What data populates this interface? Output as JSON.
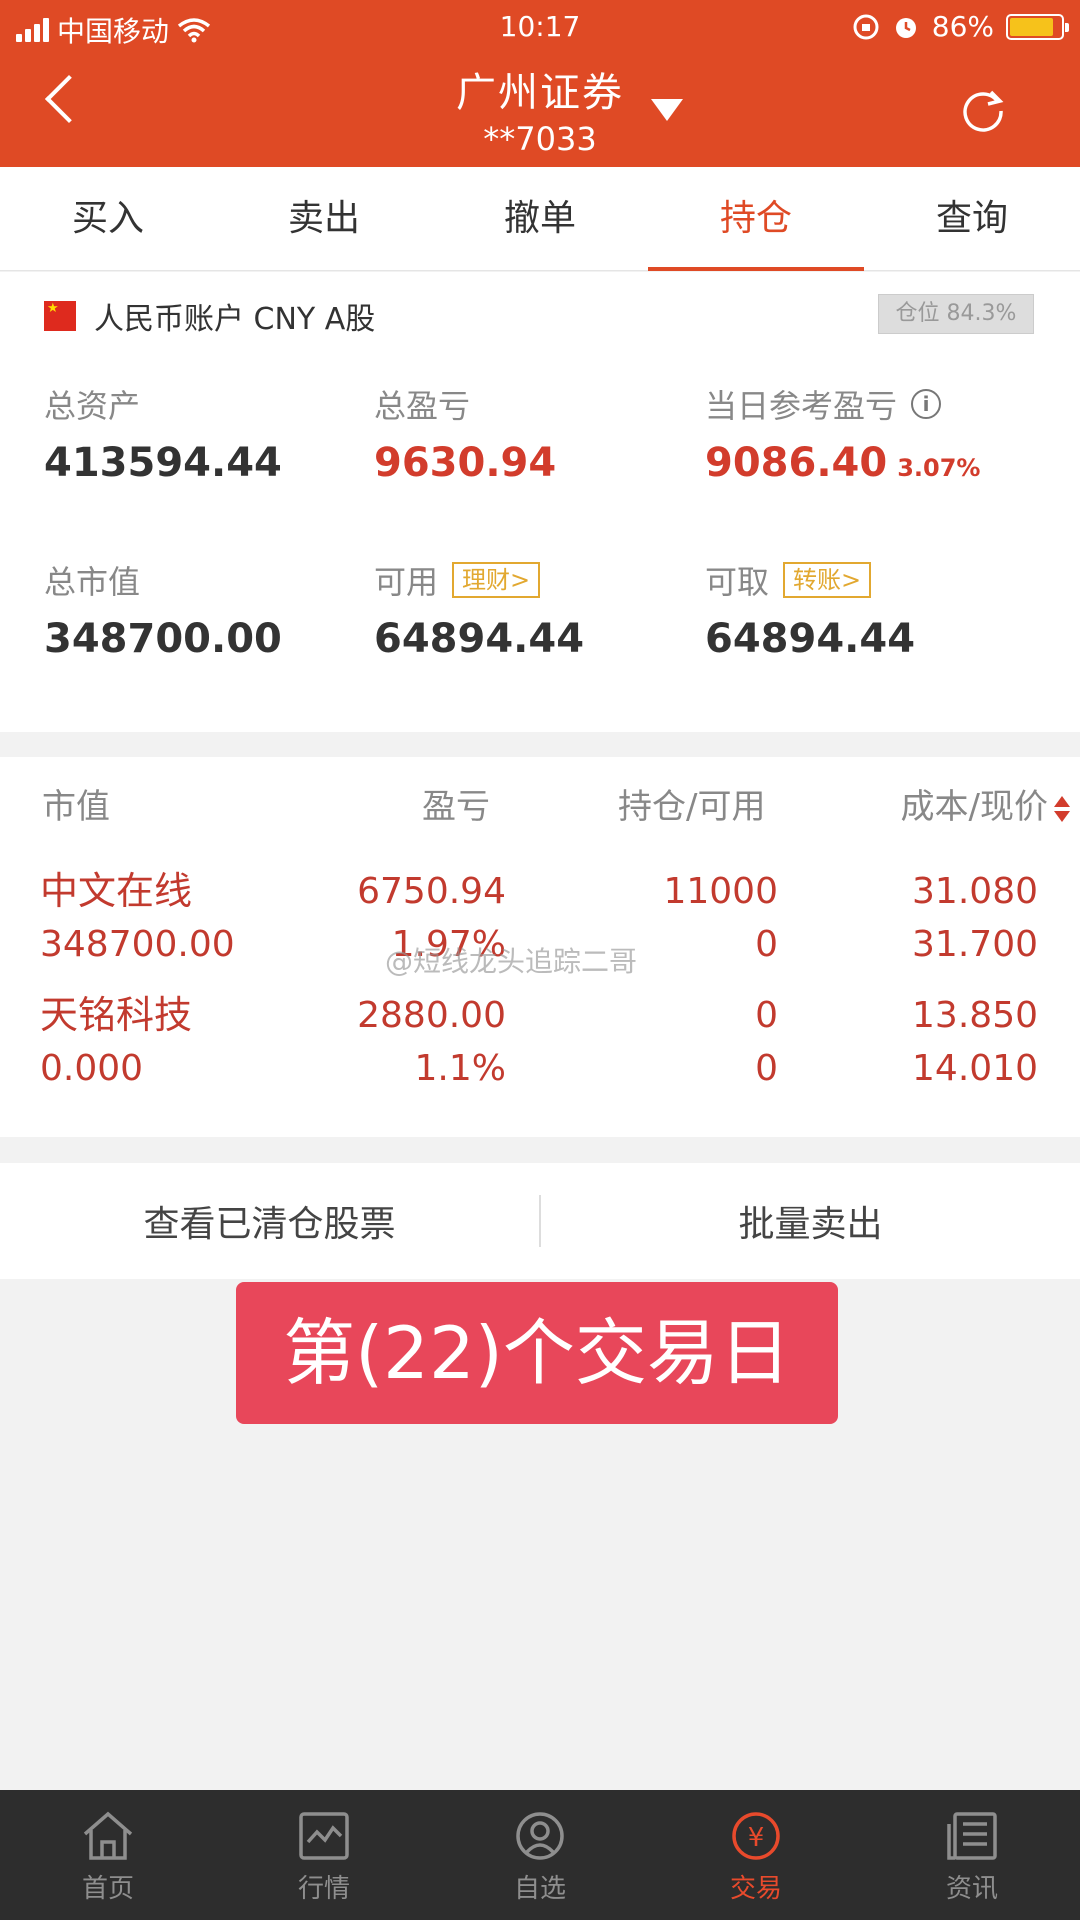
{
  "status_bar": {
    "carrier": "中国移动",
    "time": "10:17",
    "battery": "86%"
  },
  "header": {
    "title": "广州证券",
    "account": "**7033"
  },
  "tabs": [
    {
      "label": "买入"
    },
    {
      "label": "卖出"
    },
    {
      "label": "撤单"
    },
    {
      "label": "持仓",
      "active": true
    },
    {
      "label": "查询"
    }
  ],
  "account": {
    "label": "人民币账户 CNY A股",
    "position_badge": "仓位 84.3%"
  },
  "summary": {
    "total_assets_label": "总资产",
    "total_assets": "413594.44",
    "total_pl_label": "总盈亏",
    "total_pl": "9630.94",
    "daily_pl_label": "当日参考盈亏",
    "daily_pl": "9086.40",
    "daily_pl_pct": "3.07%",
    "market_value_label": "总市值",
    "market_value": "348700.00",
    "available_label": "可用",
    "available": "64894.44",
    "finance_btn": "理财>",
    "withdrawable_label": "可取",
    "withdrawable": "64894.44",
    "transfer_btn": "转账>"
  },
  "holdings": {
    "headers": [
      "市值",
      "盈亏",
      "持仓/可用",
      "成本/现价"
    ],
    "rows": [
      {
        "name": "中文在线",
        "market_value": "348700.00",
        "pl": "6750.94",
        "pl_pct": "1.97%",
        "position": "11000",
        "available": "0",
        "cost": "31.080",
        "price": "31.700"
      },
      {
        "name": "天铭科技",
        "market_value": "0.000",
        "pl": "2880.00",
        "pl_pct": "1.1%",
        "position": "0",
        "available": "0",
        "cost": "13.850",
        "price": "14.010"
      }
    ]
  },
  "actions": {
    "view_cleared": "查看已清仓股票",
    "batch_sell": "批量卖出"
  },
  "banner": "第(22)个交易日",
  "watermark": "@短线龙头追踪二哥",
  "bottom_nav": [
    {
      "label": "首页",
      "icon": "home-icon"
    },
    {
      "label": "行情",
      "icon": "chart-icon"
    },
    {
      "label": "自选",
      "icon": "watchlist-icon"
    },
    {
      "label": "交易",
      "icon": "trade-icon",
      "active": true
    },
    {
      "label": "资讯",
      "icon": "news-icon"
    }
  ],
  "colors": {
    "header_bg": "#df4a25",
    "accent_red": "#d23c2c",
    "banner_bg": "#e8475a",
    "nav_bg": "#2d2d2d"
  }
}
